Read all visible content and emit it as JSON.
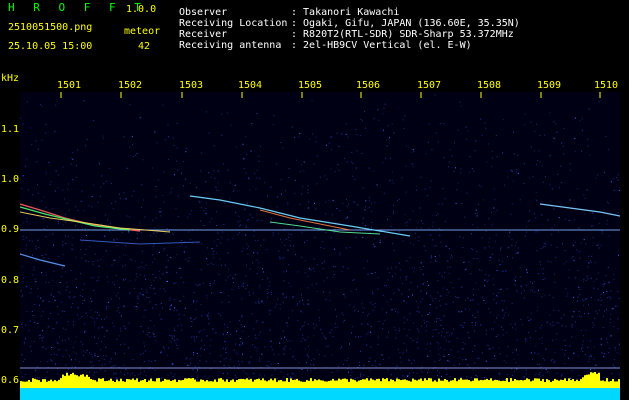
{
  "header": {
    "brand": "H R O F F T",
    "version": "1.0.0",
    "filename": "2510051500.png",
    "datetime": "25.10.05 15:00",
    "meteor_label": "meteor",
    "meteor_count": "42",
    "observer_label": "Observer",
    "observer_value": ": Takanori Kawachi",
    "location_label": "Receiving Location",
    "location_value": ": Ogaki, Gifu, JAPAN (136.60E, 35.35N)",
    "receiver_label": "Receiver",
    "receiver_value": ": R820T2(RTL-SDR) SDR-Sharp 53.372MHz",
    "antenna_label": "Receiving antenna",
    "antenna_value": ": 2el-HB9CV Vertical (el. E-W)"
  },
  "axes": {
    "y_unit": "kHz",
    "y_ticks": [
      "1.1",
      "1.0",
      "0.9",
      "0.8",
      "0.7",
      "0.6"
    ],
    "x_ticks": [
      "1501",
      "1502",
      "1503",
      "1504",
      "1505",
      "1506",
      "1507",
      "1508",
      "1509",
      "1510"
    ]
  },
  "colors": {
    "header_text": "#ffffff",
    "label_text": "#ffff00",
    "brand_text": "#00ff00",
    "background": "#000014",
    "reference_line": "#7fb0ff"
  }
}
